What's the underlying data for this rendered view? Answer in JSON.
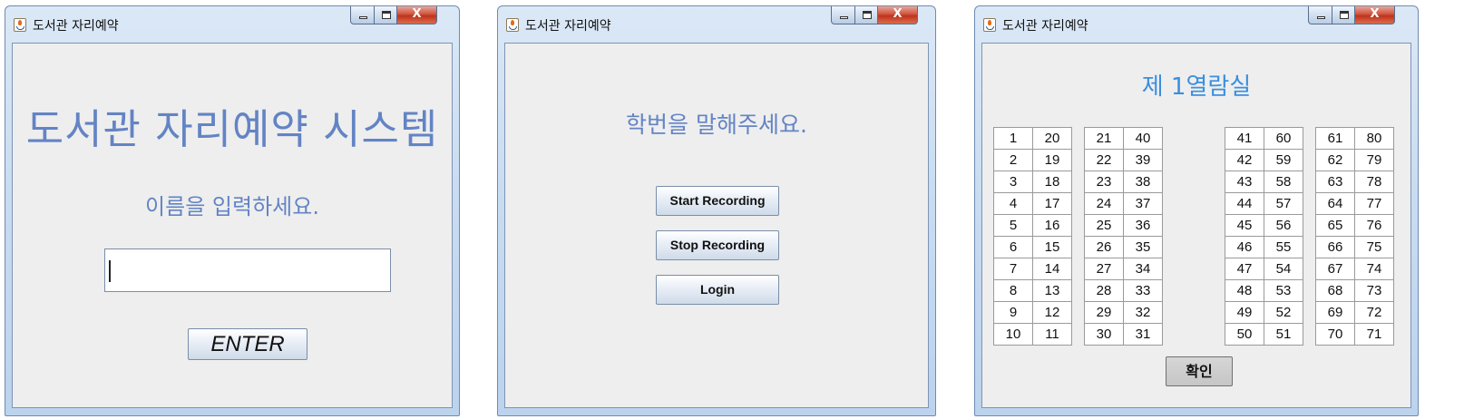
{
  "name_window": {
    "title": "도서관 자리예약",
    "heading": "도서관 자리예약 시스템",
    "prompt": "이름을 입력하세요.",
    "name_input_value": "",
    "enter_label": "ENTER",
    "close_label": "X"
  },
  "voice_window": {
    "title": "도서관 자리예약",
    "prompt": "학번을 말해주세요.",
    "start_label": "Start Recording",
    "stop_label": "Stop Recording",
    "login_label": "Login",
    "close_label": "X"
  },
  "seat_window": {
    "title": "도서관 자리예약",
    "room_title": "제 1열람실",
    "confirm_label": "확인",
    "close_label": "X",
    "seat_blocks": [
      [
        [
          "1",
          "20"
        ],
        [
          "2",
          "19"
        ],
        [
          "3",
          "18"
        ],
        [
          "4",
          "17"
        ],
        [
          "5",
          "16"
        ],
        [
          "6",
          "15"
        ],
        [
          "7",
          "14"
        ],
        [
          "8",
          "13"
        ],
        [
          "9",
          "12"
        ],
        [
          "10",
          "11"
        ]
      ],
      [
        [
          "21",
          "40"
        ],
        [
          "22",
          "39"
        ],
        [
          "23",
          "38"
        ],
        [
          "24",
          "37"
        ],
        [
          "25",
          "36"
        ],
        [
          "26",
          "35"
        ],
        [
          "27",
          "34"
        ],
        [
          "28",
          "33"
        ],
        [
          "29",
          "32"
        ],
        [
          "30",
          "31"
        ]
      ],
      [
        [
          "41",
          "60"
        ],
        [
          "42",
          "59"
        ],
        [
          "43",
          "58"
        ],
        [
          "44",
          "57"
        ],
        [
          "45",
          "56"
        ],
        [
          "46",
          "55"
        ],
        [
          "47",
          "54"
        ],
        [
          "48",
          "53"
        ],
        [
          "49",
          "52"
        ],
        [
          "50",
          "51"
        ]
      ],
      [
        [
          "61",
          "80"
        ],
        [
          "62",
          "79"
        ],
        [
          "63",
          "78"
        ],
        [
          "64",
          "77"
        ],
        [
          "65",
          "76"
        ],
        [
          "66",
          "75"
        ],
        [
          "67",
          "74"
        ],
        [
          "68",
          "73"
        ],
        [
          "69",
          "72"
        ],
        [
          "70",
          "71"
        ]
      ]
    ]
  },
  "colors": {
    "label_blue": "#6384c4",
    "room_blue": "#3a8fe0",
    "panel_bg": "#eeeeee"
  },
  "icons": {
    "app": "java-coffee-cup-icon",
    "minimize": "minimize-icon",
    "maximize": "maximize-icon",
    "close": "close-icon"
  }
}
